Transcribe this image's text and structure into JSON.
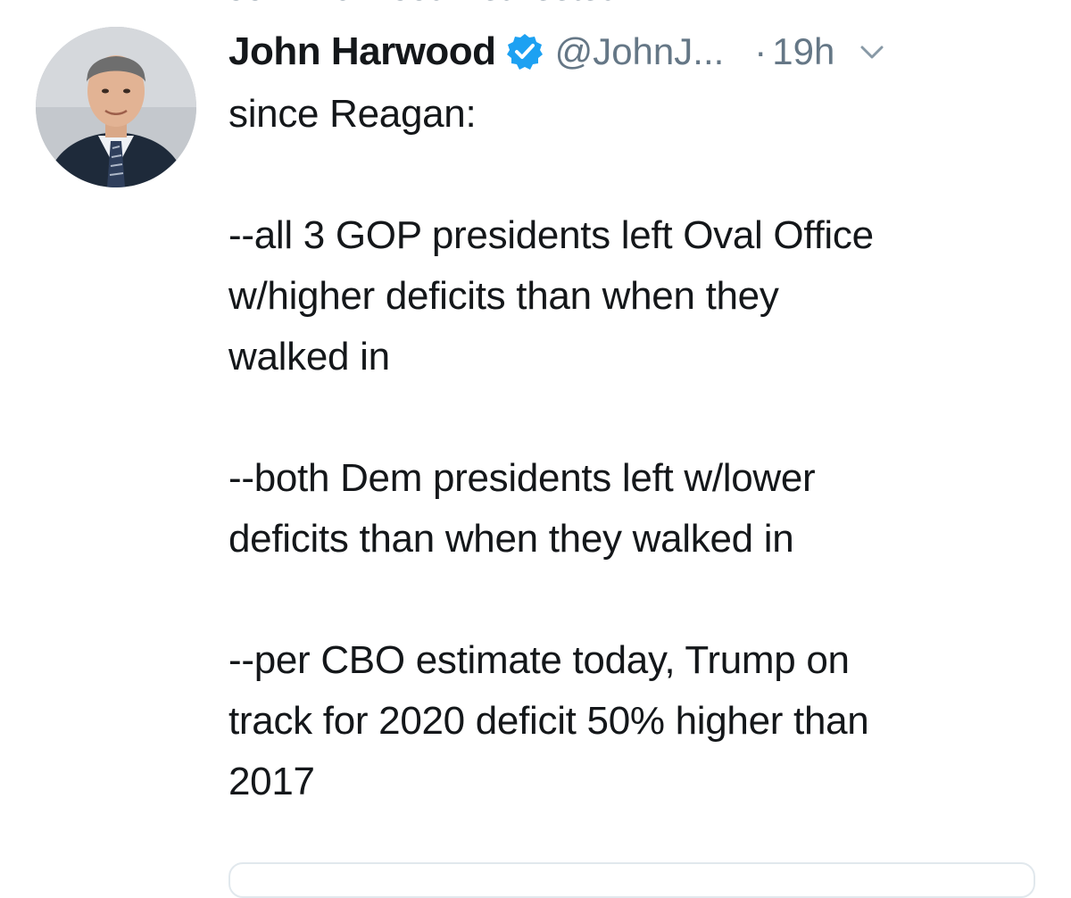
{
  "context": {
    "cut_off_text": "John Harwood Retweeted"
  },
  "tweet": {
    "author_name": "John Harwood",
    "handle": "@JohnJ...",
    "separator": "·",
    "time": "19h",
    "verified_icon": "verified-badge-icon",
    "more_icon": "chevron-down-icon",
    "lines": {
      "l1": "since Reagan:",
      "l2": "--all 3 GOP presidents left Oval Office",
      "l3": "w/higher deficits than when they",
      "l4": "walked in",
      "l5": "--both Dem presidents left w/lower",
      "l6": "deficits than when they walked in",
      "l7": "--per CBO estimate today, Trump on",
      "l8": "track for 2020 deficit 50% higher than",
      "l9": "2017"
    }
  },
  "colors": {
    "text": "#14171a",
    "secondary": "#657786",
    "verified": "#1da1f2",
    "border": "#e1e8ed"
  }
}
